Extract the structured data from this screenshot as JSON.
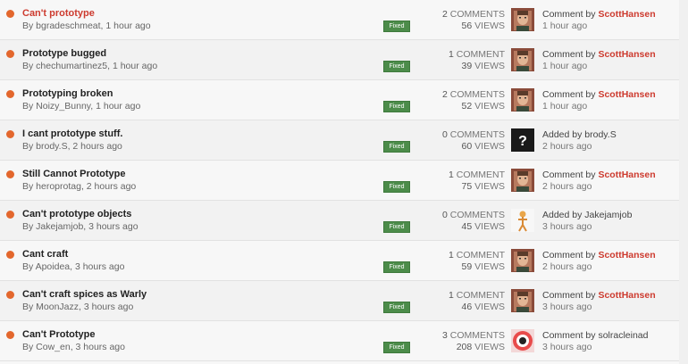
{
  "threads": [
    {
      "title": "Can't prototype",
      "byline": "By bgradeschmeat, 1 hour ago",
      "status": "Fixed",
      "comments": "2",
      "comments_label": "COMMENTS",
      "views": "56",
      "views_label": "VIEWS",
      "action": "Comment by",
      "user": "ScottHansen",
      "time": "1 hour ago",
      "avatar": "scott-avatar-icon",
      "active": true
    },
    {
      "title": "Prototype bugged",
      "byline": "By chechumartinez5, 1 hour ago",
      "status": "Fixed",
      "comments": "1",
      "comments_label": "COMMENT",
      "views": "39",
      "views_label": "VIEWS",
      "action": "Comment by",
      "user": "ScottHansen",
      "time": "1 hour ago",
      "avatar": "scott-avatar-icon"
    },
    {
      "title": "Prototyping broken",
      "byline": "By Noizy_Bunny, 1 hour ago",
      "status": "Fixed",
      "comments": "2",
      "comments_label": "COMMENTS",
      "views": "52",
      "views_label": "VIEWS",
      "action": "Comment by",
      "user": "ScottHansen",
      "time": "1 hour ago",
      "avatar": "scott-avatar-icon"
    },
    {
      "title": "I cant prototype stuff.",
      "byline": "By brody.S, 2 hours ago",
      "status": "Fixed",
      "comments": "0",
      "comments_label": "COMMENTS",
      "views": "60",
      "views_label": "VIEWS",
      "action": "Added by",
      "user": "brody.S",
      "time": "2 hours ago",
      "avatar": "unknown-avatar-icon"
    },
    {
      "title": "Still Cannot Prototype",
      "byline": "By heroprotag, 2 hours ago",
      "status": "Fixed",
      "comments": "1",
      "comments_label": "COMMENT",
      "views": "75",
      "views_label": "VIEWS",
      "action": "Comment by",
      "user": "ScottHansen",
      "time": "2 hours ago",
      "avatar": "scott-avatar-icon"
    },
    {
      "title": "Can't prototype objects",
      "byline": "By Jakejamjob, 3 hours ago",
      "status": "Fixed",
      "comments": "0",
      "comments_label": "COMMENTS",
      "views": "45",
      "views_label": "VIEWS",
      "action": "Added by",
      "user": "Jakejamjob",
      "time": "3 hours ago",
      "avatar": "character-avatar-icon"
    },
    {
      "title": "Cant craft",
      "byline": "By Apoidea, 3 hours ago",
      "status": "Fixed",
      "comments": "1",
      "comments_label": "COMMENT",
      "views": "59",
      "views_label": "VIEWS",
      "action": "Comment by",
      "user": "ScottHansen",
      "time": "2 hours ago",
      "avatar": "scott-avatar-icon"
    },
    {
      "title": "Can't craft spices as Warly",
      "byline": "By MoonJazz, 3 hours ago",
      "status": "Fixed",
      "comments": "1",
      "comments_label": "COMMENT",
      "views": "46",
      "views_label": "VIEWS",
      "action": "Comment by",
      "user": "ScottHansen",
      "time": "3 hours ago",
      "avatar": "scott-avatar-icon"
    },
    {
      "title": "Can't Prototype",
      "byline": "By Cow_en, 3 hours ago",
      "status": "Fixed",
      "comments": "3",
      "comments_label": "COMMENTS",
      "views": "208",
      "views_label": "VIEWS",
      "action": "Comment by",
      "user": "solracleinad",
      "time": "3 hours ago",
      "avatar": "eye-avatar-icon"
    }
  ],
  "colors": {
    "accent": "#cd3b2f",
    "unread_dot": "#e3672d",
    "fixed_badge": "#4c8c4a"
  }
}
